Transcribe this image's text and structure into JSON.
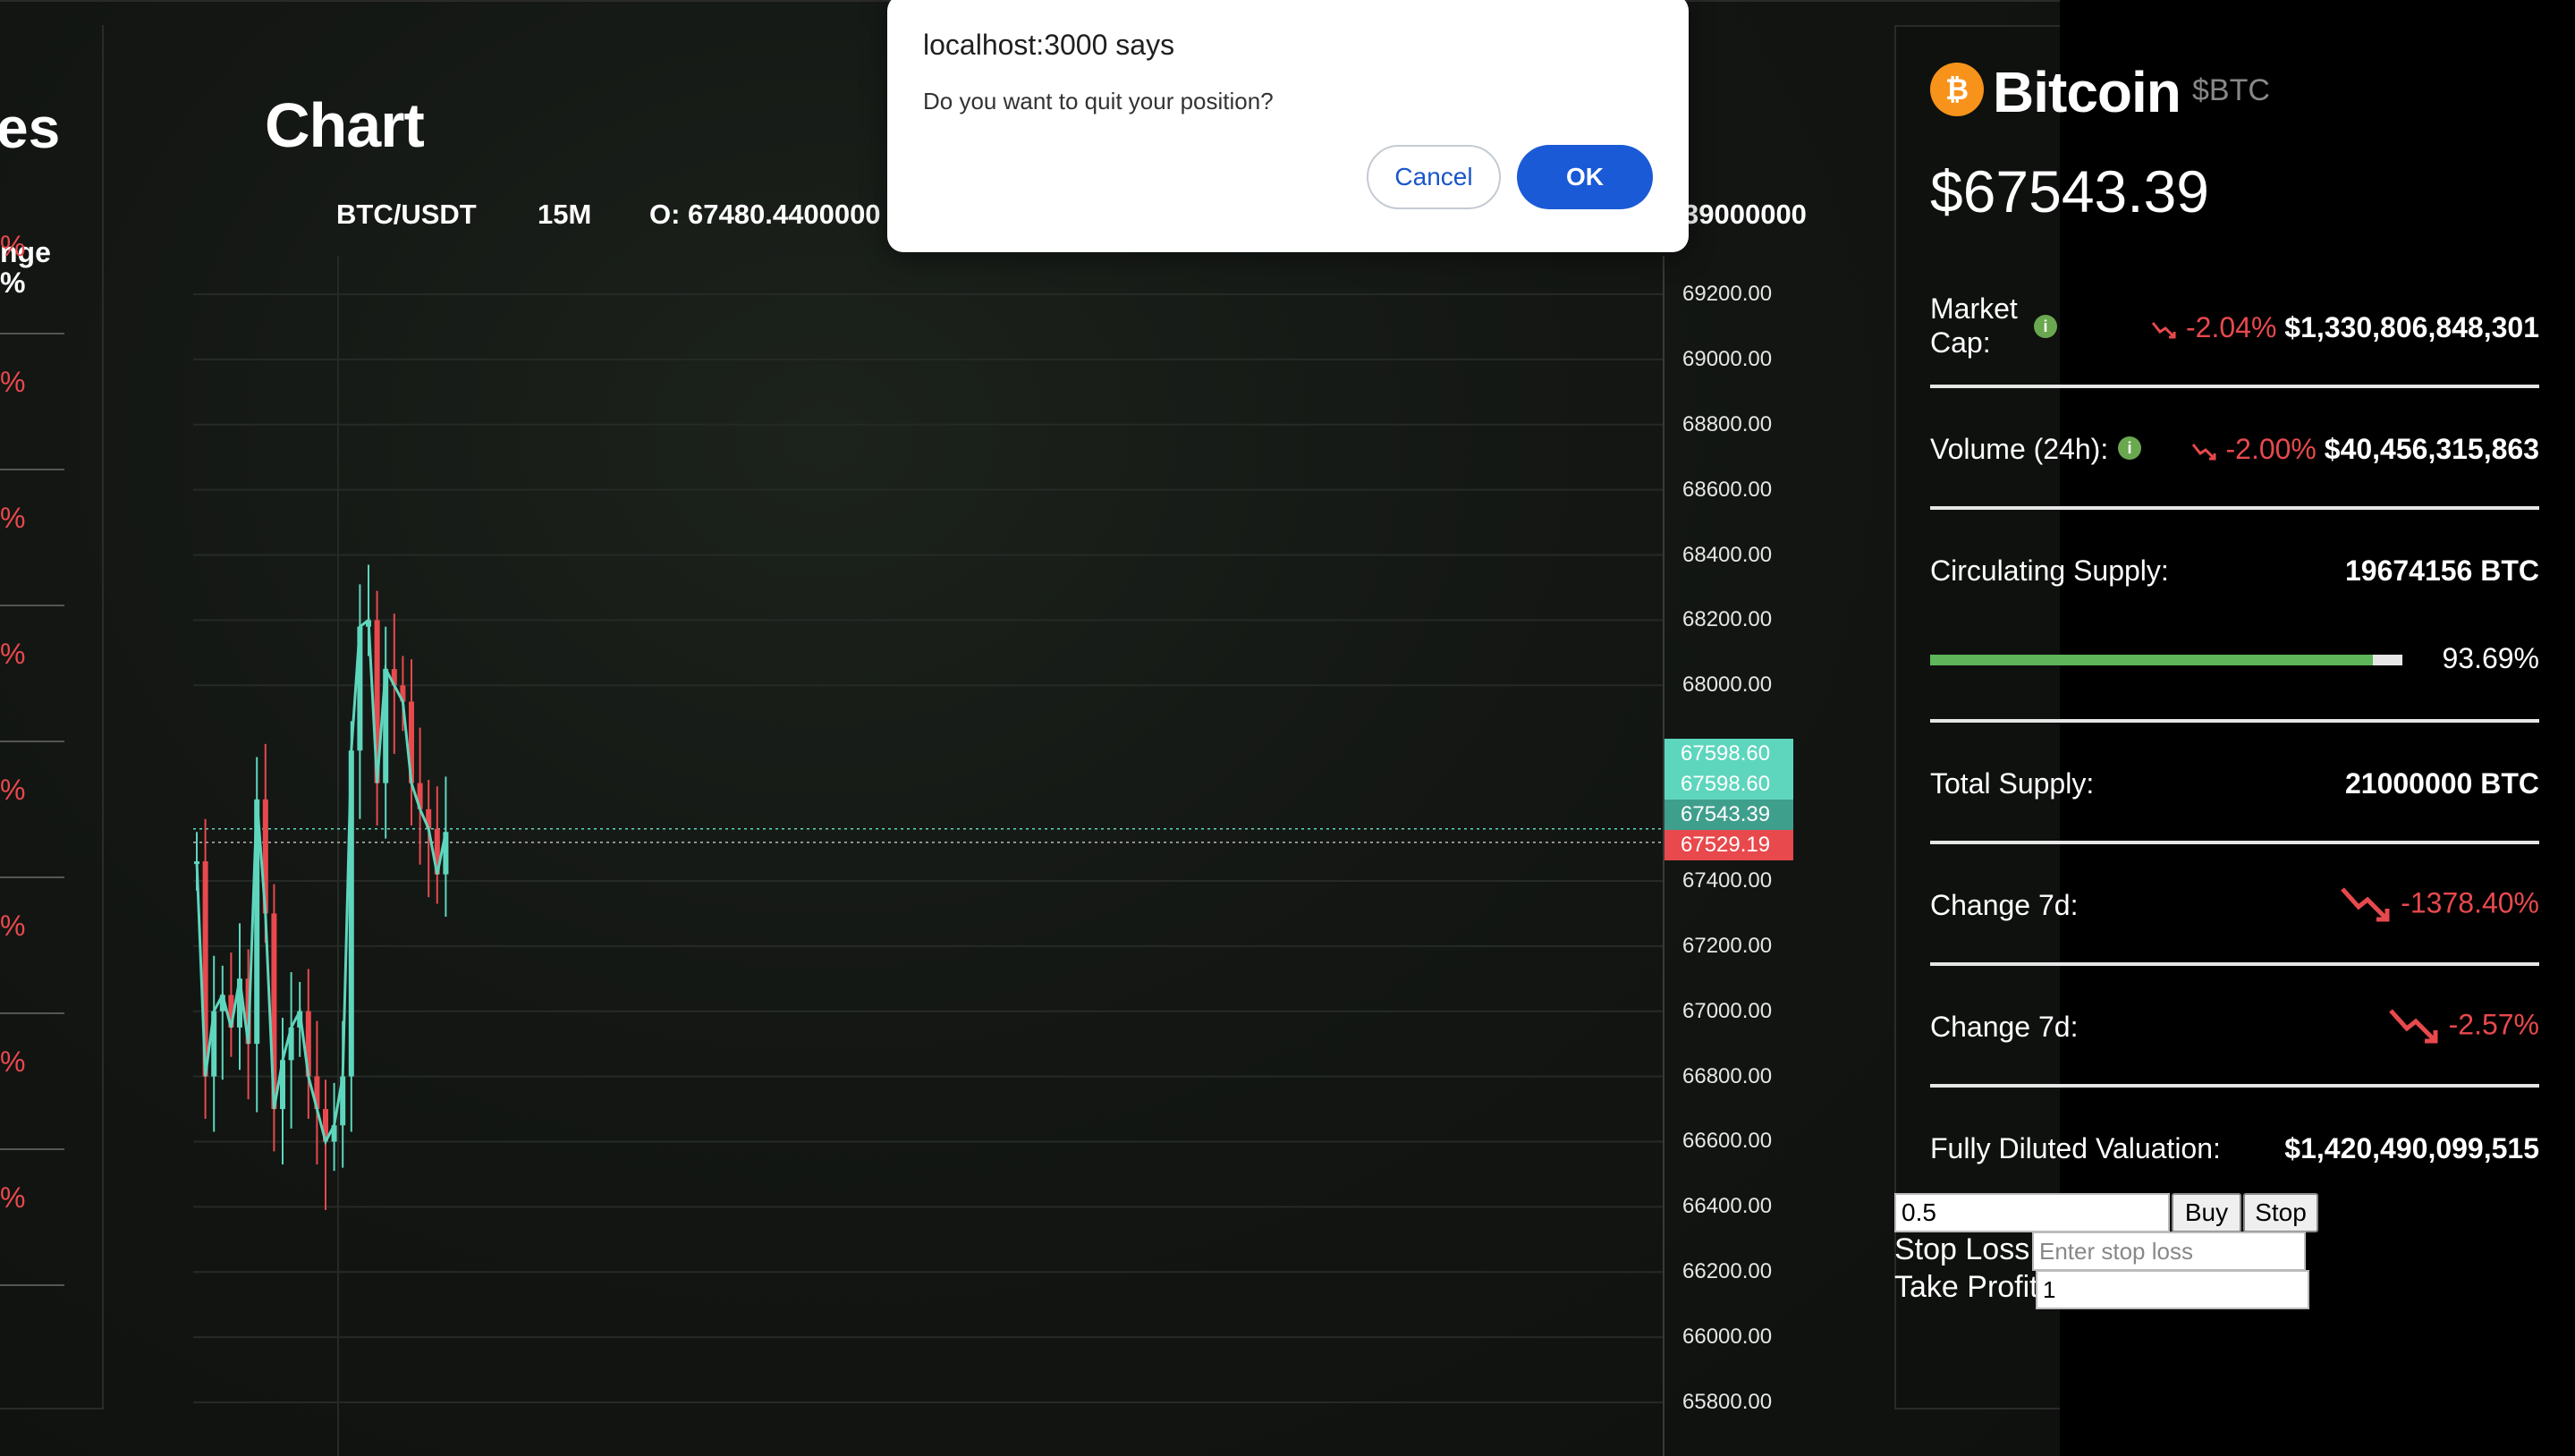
{
  "left_panel": {
    "title_fragment": "es",
    "col_header_line1": "nge",
    "col_header_line2": "%",
    "rows": [
      "%",
      "%",
      "%",
      "%",
      "%",
      "%",
      "%",
      "%"
    ]
  },
  "chart": {
    "title": "Chart",
    "pair": "BTC/USDT",
    "timeframe": "15M",
    "open_label": "O: 67480.4400000",
    "right_value": "39000000",
    "axis_ticks": [
      "69200.00",
      "69000.00",
      "68800.00",
      "68600.00",
      "68400.00",
      "68200.00",
      "68000.00",
      "67400.00",
      "67200.00",
      "67000.00",
      "66800.00",
      "66600.00",
      "66400.00",
      "66200.00",
      "66000.00",
      "65800.00"
    ],
    "price_tags": [
      {
        "label": "67598.60",
        "color": "#5ed6bd"
      },
      {
        "label": "67598.60",
        "color": "#5ed6bd"
      },
      {
        "label": "67543.39",
        "color": "#3f9f8d"
      },
      {
        "label": "67529.19",
        "color": "#e8494d"
      }
    ],
    "colors": {
      "up": "#5ed6bd",
      "down": "#e8494d",
      "grid": "#262a26"
    }
  },
  "chart_data": {
    "type": "line",
    "title": "",
    "xlabel": "",
    "ylabel": "",
    "ylim": [
      65750,
      69300
    ],
    "series": [
      {
        "values": [
          67460,
          66800,
          67000,
          67050,
          66950,
          67100,
          66900,
          67650,
          67300,
          66700,
          66850,
          66950,
          67000,
          66800,
          66700,
          66600,
          66650,
          66800,
          67800,
          68180,
          68200,
          67700,
          68050,
          68000,
          67950,
          67700,
          67620,
          67560,
          67420,
          67550
        ]
      }
    ]
  },
  "info": {
    "coin_name": "Bitcoin",
    "coin_symbol": "$BTC",
    "coin_icon": "bitcoin-icon",
    "price": "$67543.39",
    "market_cap_label_1": "Market",
    "market_cap_label_2": "Cap:",
    "market_cap_change": "-2.04%",
    "market_cap_value": "$1,330,806,848,301",
    "volume_label": "Volume (24h):",
    "volume_change": "-2.00%",
    "volume_value": "$40,456,315,863",
    "circulating_label": "Circulating Supply:",
    "circulating_value": "19674156 BTC",
    "supply_fraction": 0.9369,
    "supply_pct": "93.69%",
    "total_supply_label": "Total Supply:",
    "total_supply_value": "21000000 BTC",
    "change_7d_label_a": "Change 7d:",
    "change_7d_value_a": "-1378.40%",
    "change_7d_label_b": "Change 7d:",
    "change_7d_value_b": "-2.57%",
    "fdv_label": "Fully Diluted Valuation:",
    "fdv_value": "$1,420,490,099,515",
    "info_glyph": "i"
  },
  "order_form": {
    "quantity": "0.5",
    "buy_label": "Buy",
    "stop_label": "Stop",
    "stop_loss_label": "Stop Loss:",
    "stop_loss_placeholder": "Enter stop loss",
    "take_profit_label": "Take Profit:",
    "take_profit_value": "1"
  },
  "dialog": {
    "title": "localhost:3000 says",
    "message": "Do you want to quit your position?",
    "cancel_label": "Cancel",
    "ok_label": "OK"
  }
}
